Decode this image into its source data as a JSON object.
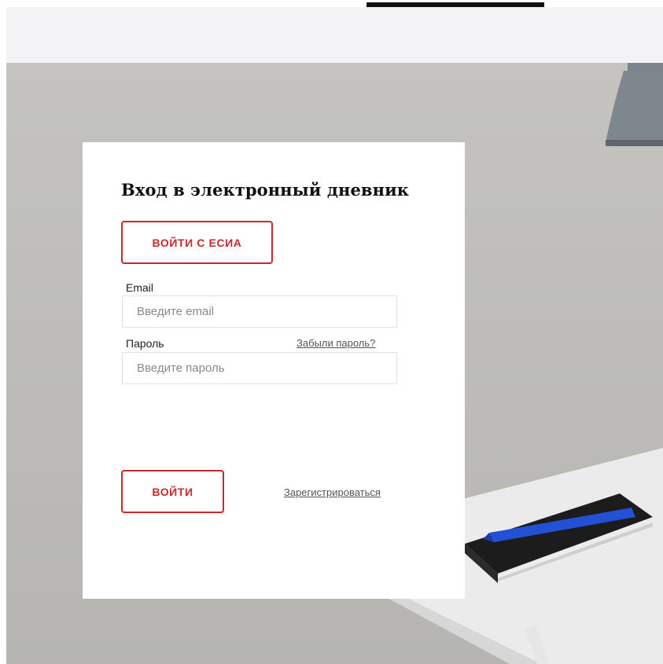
{
  "login": {
    "title": "Вход в электронный дневник",
    "esia_button_label": "Войти с ЕСИА",
    "email_label": "Email",
    "email_placeholder": "Введите email",
    "email_value": "",
    "password_label": "Пароль",
    "password_placeholder": "Введите пароль",
    "password_value": "",
    "forgot_password_label": "Забыли пароль?",
    "submit_button_label": "Войти",
    "register_label": "Зарегистрироваться"
  },
  "colors": {
    "accent": "#c82a2a",
    "header_background": "#f3f3f5",
    "card_background": "#ffffff"
  },
  "icons": {
    "hero_image": "desk-lamp-notebook-pen-photo"
  }
}
